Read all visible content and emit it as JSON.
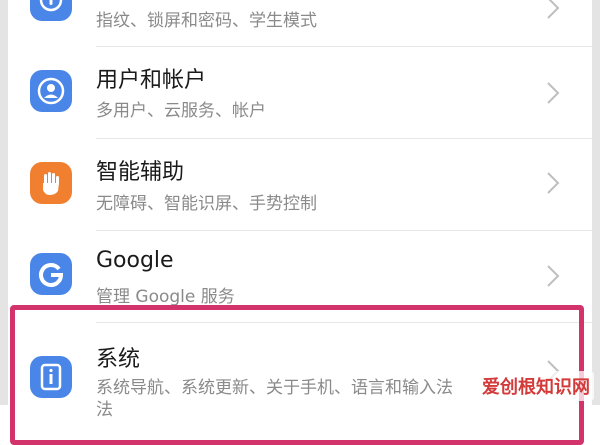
{
  "settings": {
    "items": [
      {
        "title": "",
        "subtitle": "指纹、锁屏和密码、学生模式",
        "icon": "security-icon",
        "color": "#4a86e8"
      },
      {
        "title": "用户和帐户",
        "subtitle": "多用户、云服务、帐户",
        "icon": "user-account-icon",
        "color": "#4a86e8"
      },
      {
        "title": "智能辅助",
        "subtitle": "无障碍、智能识屏、手势控制",
        "icon": "hand-icon",
        "color": "#f08030"
      },
      {
        "title": "Google",
        "subtitle": "管理 Google 服务",
        "icon": "google-icon",
        "color": "#4a86e8"
      },
      {
        "title": "系统",
        "subtitle": "系统导航、系统更新、关于手机、语言和输入法",
        "icon": "system-info-icon",
        "color": "#4a86e8"
      }
    ],
    "partial_next_line": "法"
  },
  "highlight_color": "#d3336b",
  "watermark": {
    "text": "爱创根知识网"
  }
}
